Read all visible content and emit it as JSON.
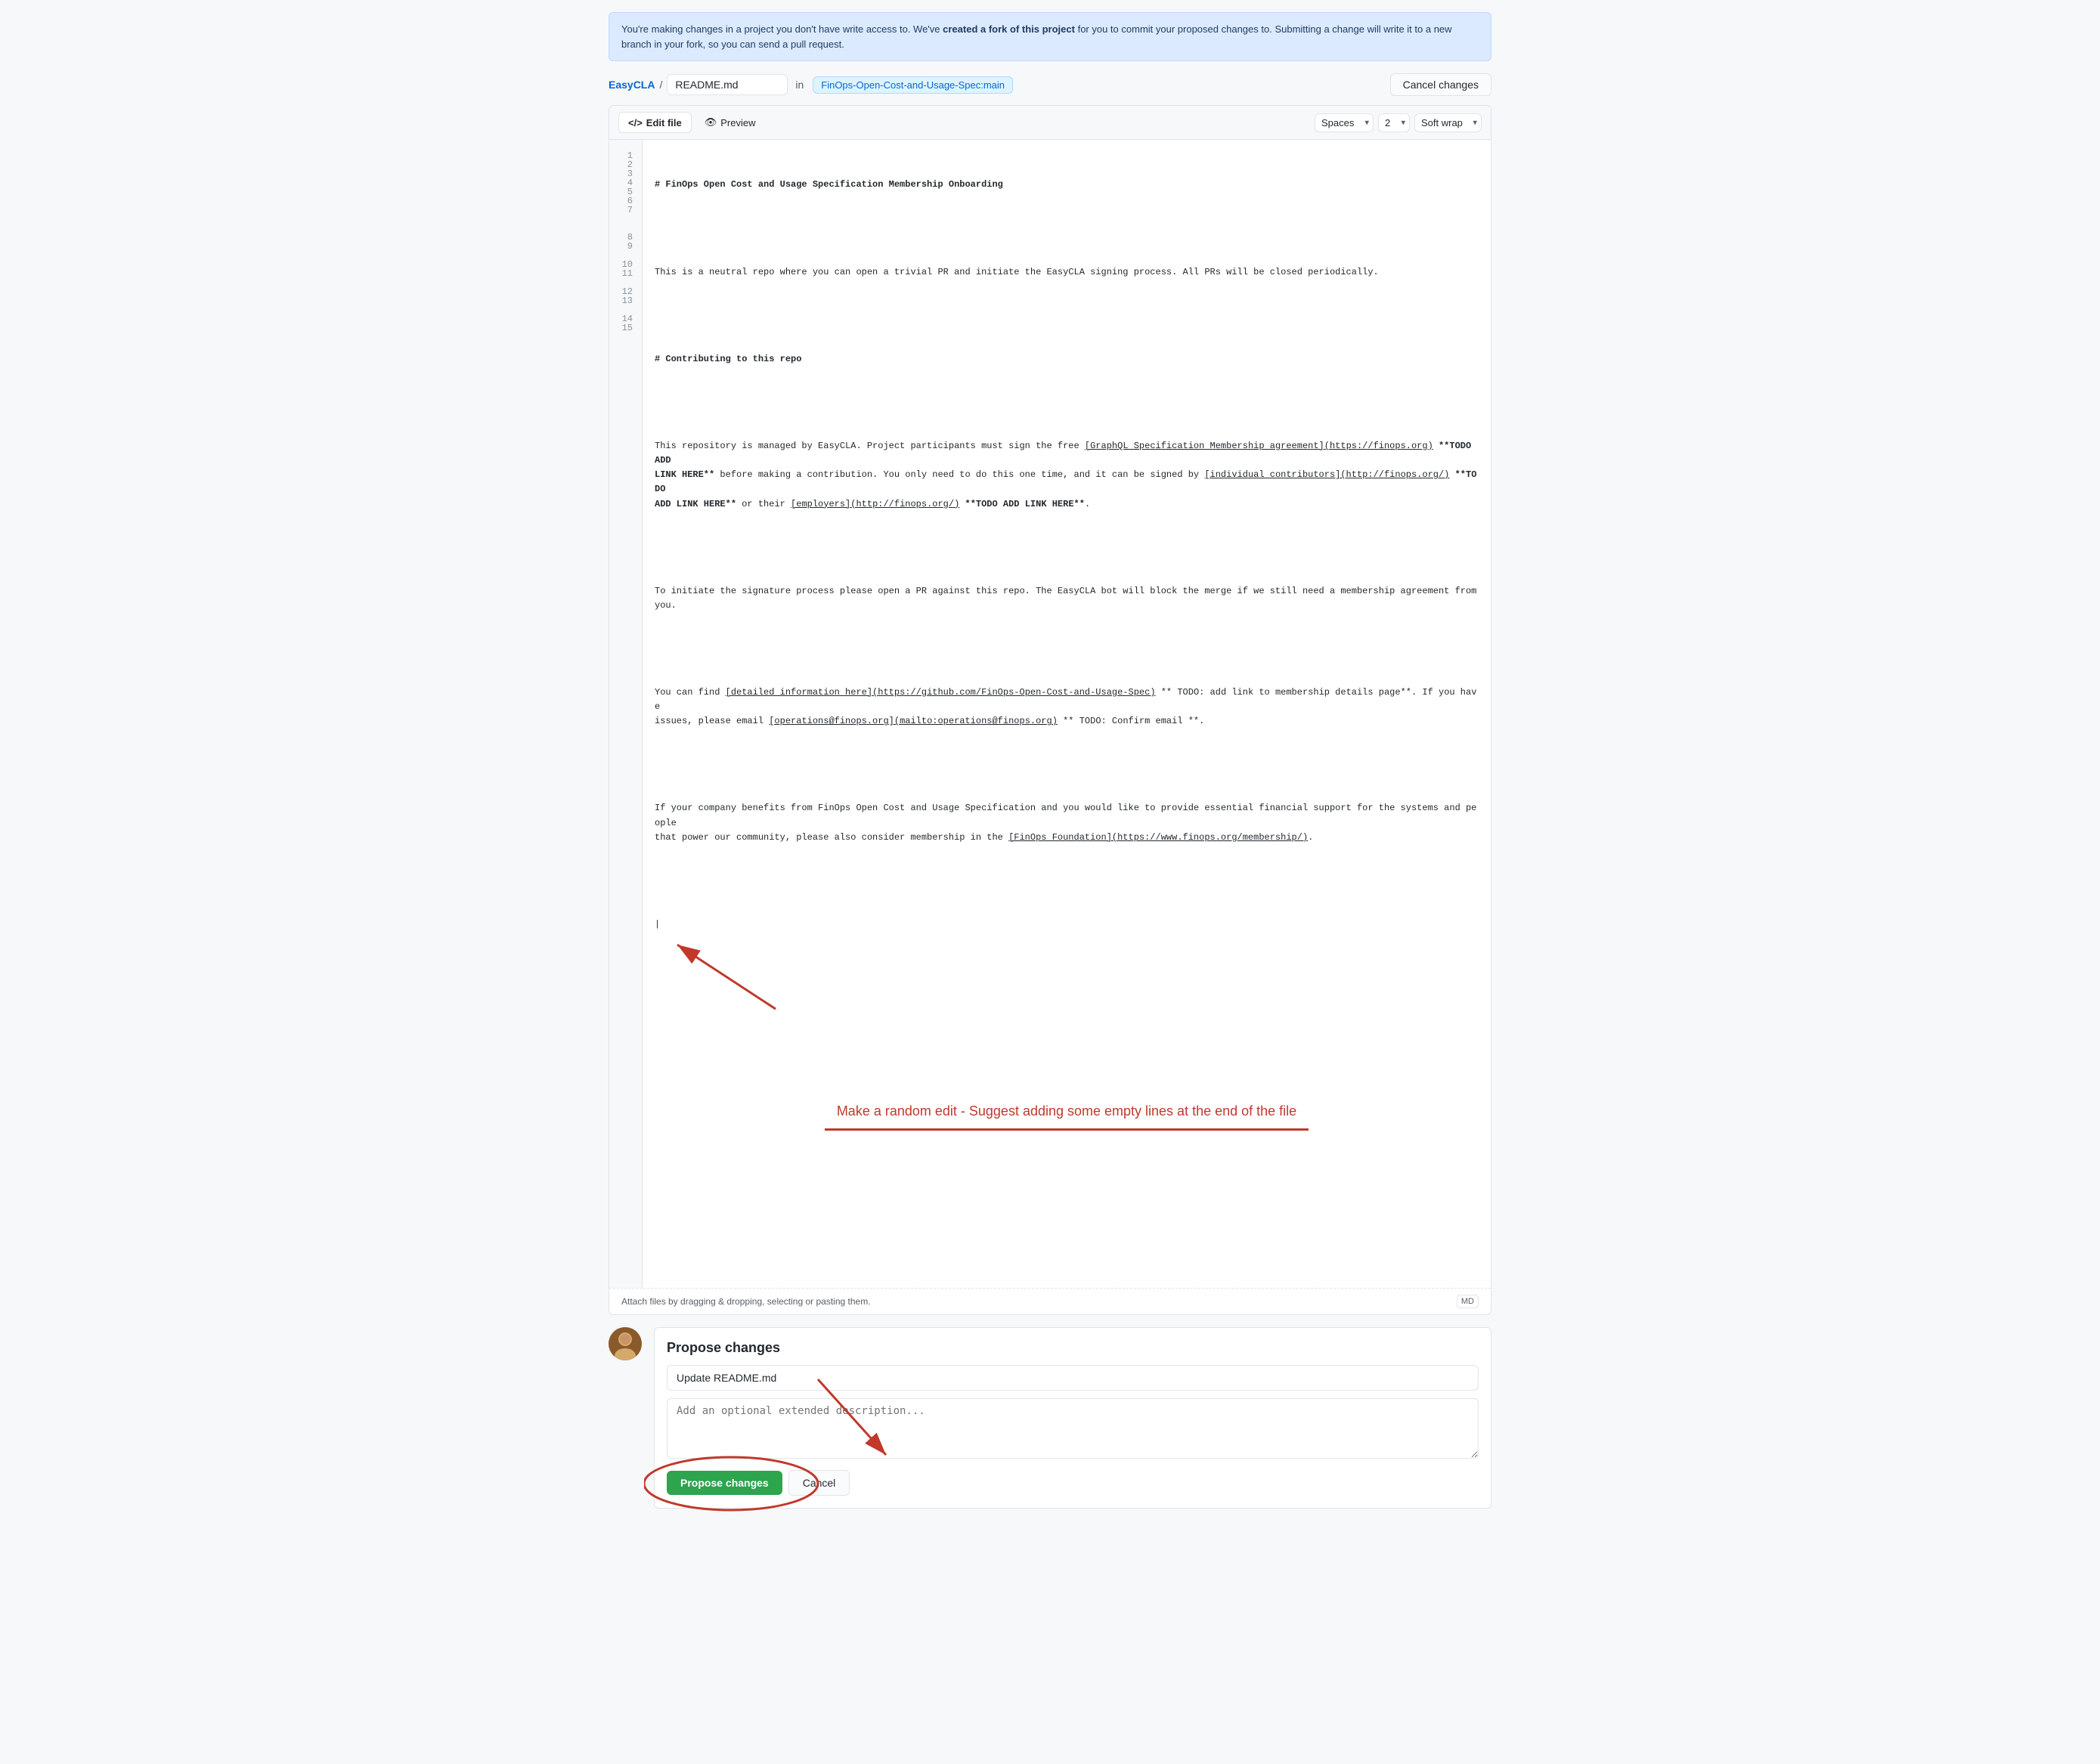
{
  "banner": {
    "text_start": "You're making changes in a project you don't have write access to. We've ",
    "text_bold": "created a fork of this project",
    "text_end": " for you to commit your proposed changes to. Submitting a change will write it to a new branch in your fork, so you can send a pull request."
  },
  "breadcrumb": {
    "repo_name": "EasyCLA",
    "separator": "/",
    "filename": "README.md",
    "in_label": "in",
    "branch": "FinOps-Open-Cost-and-Usage-Spec:main",
    "cancel_label": "Cancel changes"
  },
  "editor": {
    "tab_edit_label": "Edit file",
    "tab_preview_label": "Preview",
    "spaces_label": "Spaces",
    "indent_value": "2",
    "softwrap_label": "Soft wrap",
    "lines": [
      {
        "num": "1",
        "content": "# FinOps Open Cost and Usage Specification Membership Onboarding",
        "bold": true
      },
      {
        "num": "2",
        "content": ""
      },
      {
        "num": "3",
        "content": "This is a neutral repo where you can open a trivial PR and initiate the EasyCLA signing process. All PRs will be closed periodically."
      },
      {
        "num": "4",
        "content": ""
      },
      {
        "num": "5",
        "content": "# Contributing to this repo",
        "bold": true
      },
      {
        "num": "6",
        "content": ""
      },
      {
        "num": "7",
        "content": "This repository is managed by EasyCLA. Project participants must sign the free [GraphQL Specification Membership agreement](https://finops.org) **TODO ADD LINK HERE** before making a contribution. You only need to do this one time, and it can be signed by [individual contributors](http://finops.org/) **TODO ADD LINK HERE** or their [employers](http://finops.org/) **TODO ADD LINK HERE**."
      },
      {
        "num": "8",
        "content": ""
      },
      {
        "num": "9",
        "content": "To initiate the signature process please open a PR against this repo. The EasyCLA bot will block the merge if we still need a membership agreement from you."
      },
      {
        "num": "10",
        "content": ""
      },
      {
        "num": "11",
        "content": "You can find [detailed information here](https://github.com/FinOps-Open-Cost-and-Usage-Spec) ** TODO: add link to membership details page**. If you have issues, please email [operations@finops.org](mailto:operations@finops.org) ** TODO: Confirm email **."
      },
      {
        "num": "12",
        "content": ""
      },
      {
        "num": "13",
        "content": "If your company benefits from FinOps Open Cost and Usage Specification and you would like to provide essential financial support for the systems and people that power our community, please also consider membership in the [FinOps Foundation](https://www.finops.org/membership/)."
      },
      {
        "num": "14",
        "content": ""
      },
      {
        "num": "15",
        "content": "|"
      }
    ],
    "annotation_text": "Make a random edit - Suggest adding some empty lines at the end of the file",
    "attach_label": "Attach files by dragging & dropping, selecting or pasting them.",
    "md_badge": "MD"
  },
  "propose": {
    "title": "Propose changes",
    "commit_placeholder": "Update README.md",
    "commit_value": "Update README.md",
    "description_placeholder": "Add an optional extended description...",
    "propose_btn_label": "Propose changes",
    "cancel_btn_label": "Cancel"
  },
  "colors": {
    "accent": "#0366d6",
    "annotation": "#c0392b",
    "propose_green": "#2da44e"
  }
}
